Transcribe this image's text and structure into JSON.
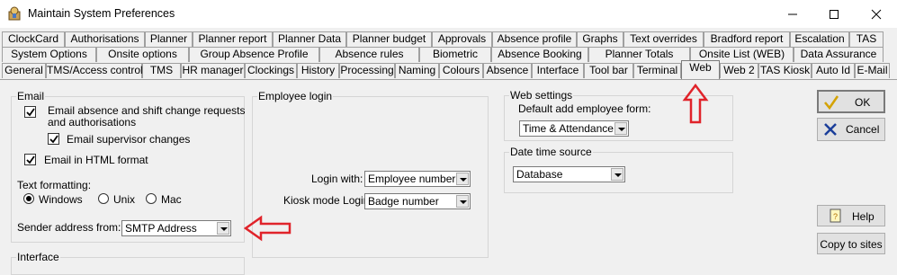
{
  "window": {
    "title": "Maintain System Preferences",
    "controls": {
      "minimize": "minimize-icon",
      "maximize": "maximize-icon",
      "close": "close-icon"
    }
  },
  "tabs": {
    "row1": [
      "ClockCard",
      "Authorisations",
      "Planner",
      "Planner report",
      "Planner Data",
      "Planner budget",
      "Approvals",
      "Absence profile",
      "Graphs",
      "Text overrides",
      "Bradford report",
      "Escalation",
      "TAS"
    ],
    "row2": [
      "System Options",
      "Onsite options",
      "Group Absence Profile",
      "Absence rules",
      "Biometric",
      "Absence Booking",
      "Planner Totals",
      "Onsite List (WEB)",
      "Data Assurance"
    ],
    "row3": [
      "General",
      "TMS/Access control",
      "TMS",
      "HR manager",
      "Clockings",
      "History",
      "Processing",
      "Naming",
      "Colours",
      "Absence",
      "Interface",
      "Tool bar",
      "Terminal",
      "Web",
      "Web 2",
      "TAS Kiosk",
      "Auto Id",
      "E-Mail"
    ],
    "active": "Web"
  },
  "email": {
    "group_label": "Email",
    "absence_requests_label_line1": "Email absence and shift change requests",
    "absence_requests_label_line2": "and authorisations",
    "absence_requests_checked": true,
    "supervisor_label": "Email supervisor changes",
    "supervisor_checked": true,
    "html_label": "Email in HTML format",
    "html_checked": true,
    "text_formatting_label": "Text formatting:",
    "formatting_options": [
      "Windows",
      "Unix",
      "Mac"
    ],
    "formatting_selected": "Windows",
    "sender_label": "Sender address from:",
    "sender_value": "SMTP Address"
  },
  "interface": {
    "group_label": "Interface"
  },
  "employee_login": {
    "group_label": "Employee login",
    "login_with_label": "Login with:",
    "login_with_value": "Employee number",
    "kiosk_label": "Kiosk mode Login:",
    "kiosk_value": "Badge number"
  },
  "web_settings": {
    "group_label": "Web settings",
    "default_form_label": "Default add employee form:",
    "default_form_value": "Time & Attendance"
  },
  "date_time_source": {
    "group_label": "Date time source",
    "value": "Database"
  },
  "buttons": {
    "ok": "OK",
    "cancel": "Cancel",
    "help": "Help",
    "copy": "Copy to sites"
  },
  "colors": {
    "annotation_red": "#e0232a",
    "window_bg": "#f0f0f0"
  }
}
